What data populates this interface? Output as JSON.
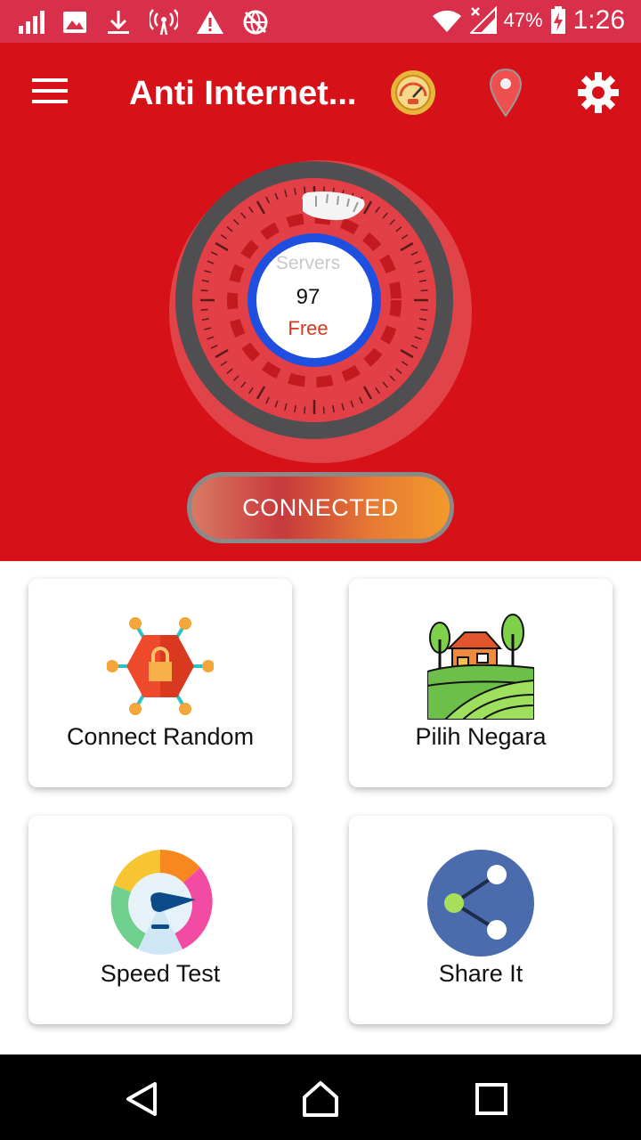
{
  "status_bar": {
    "battery_percent": "47%",
    "time": "1:26",
    "icons": [
      "signal-icon",
      "image-icon",
      "download-icon",
      "hotspot-icon",
      "warning-icon",
      "vpn-globe-icon",
      "wifi-icon",
      "mobile-signal-icon",
      "battery-charging-icon"
    ]
  },
  "app_bar": {
    "title": "Anti Internet...",
    "icons": [
      "menu-icon",
      "speed-gauge-icon",
      "location-pin-icon",
      "settings-gear-icon"
    ]
  },
  "dial": {
    "label": "Servers",
    "count": "97",
    "tier": "Free"
  },
  "connect_button": {
    "label": "CONNECTED"
  },
  "cards": [
    {
      "label": "Connect Random",
      "icon": "connect-random-icon"
    },
    {
      "label": "Pilih Negara",
      "icon": "country-landscape-icon"
    },
    {
      "label": "Speed Test",
      "icon": "speedometer-icon"
    },
    {
      "label": "Share It",
      "icon": "share-icon"
    }
  ],
  "colors": {
    "app_red": "#d71118",
    "status_red": "#d8304a",
    "ring_blue": "#1f4fe0",
    "free_text": "#d9381e"
  }
}
